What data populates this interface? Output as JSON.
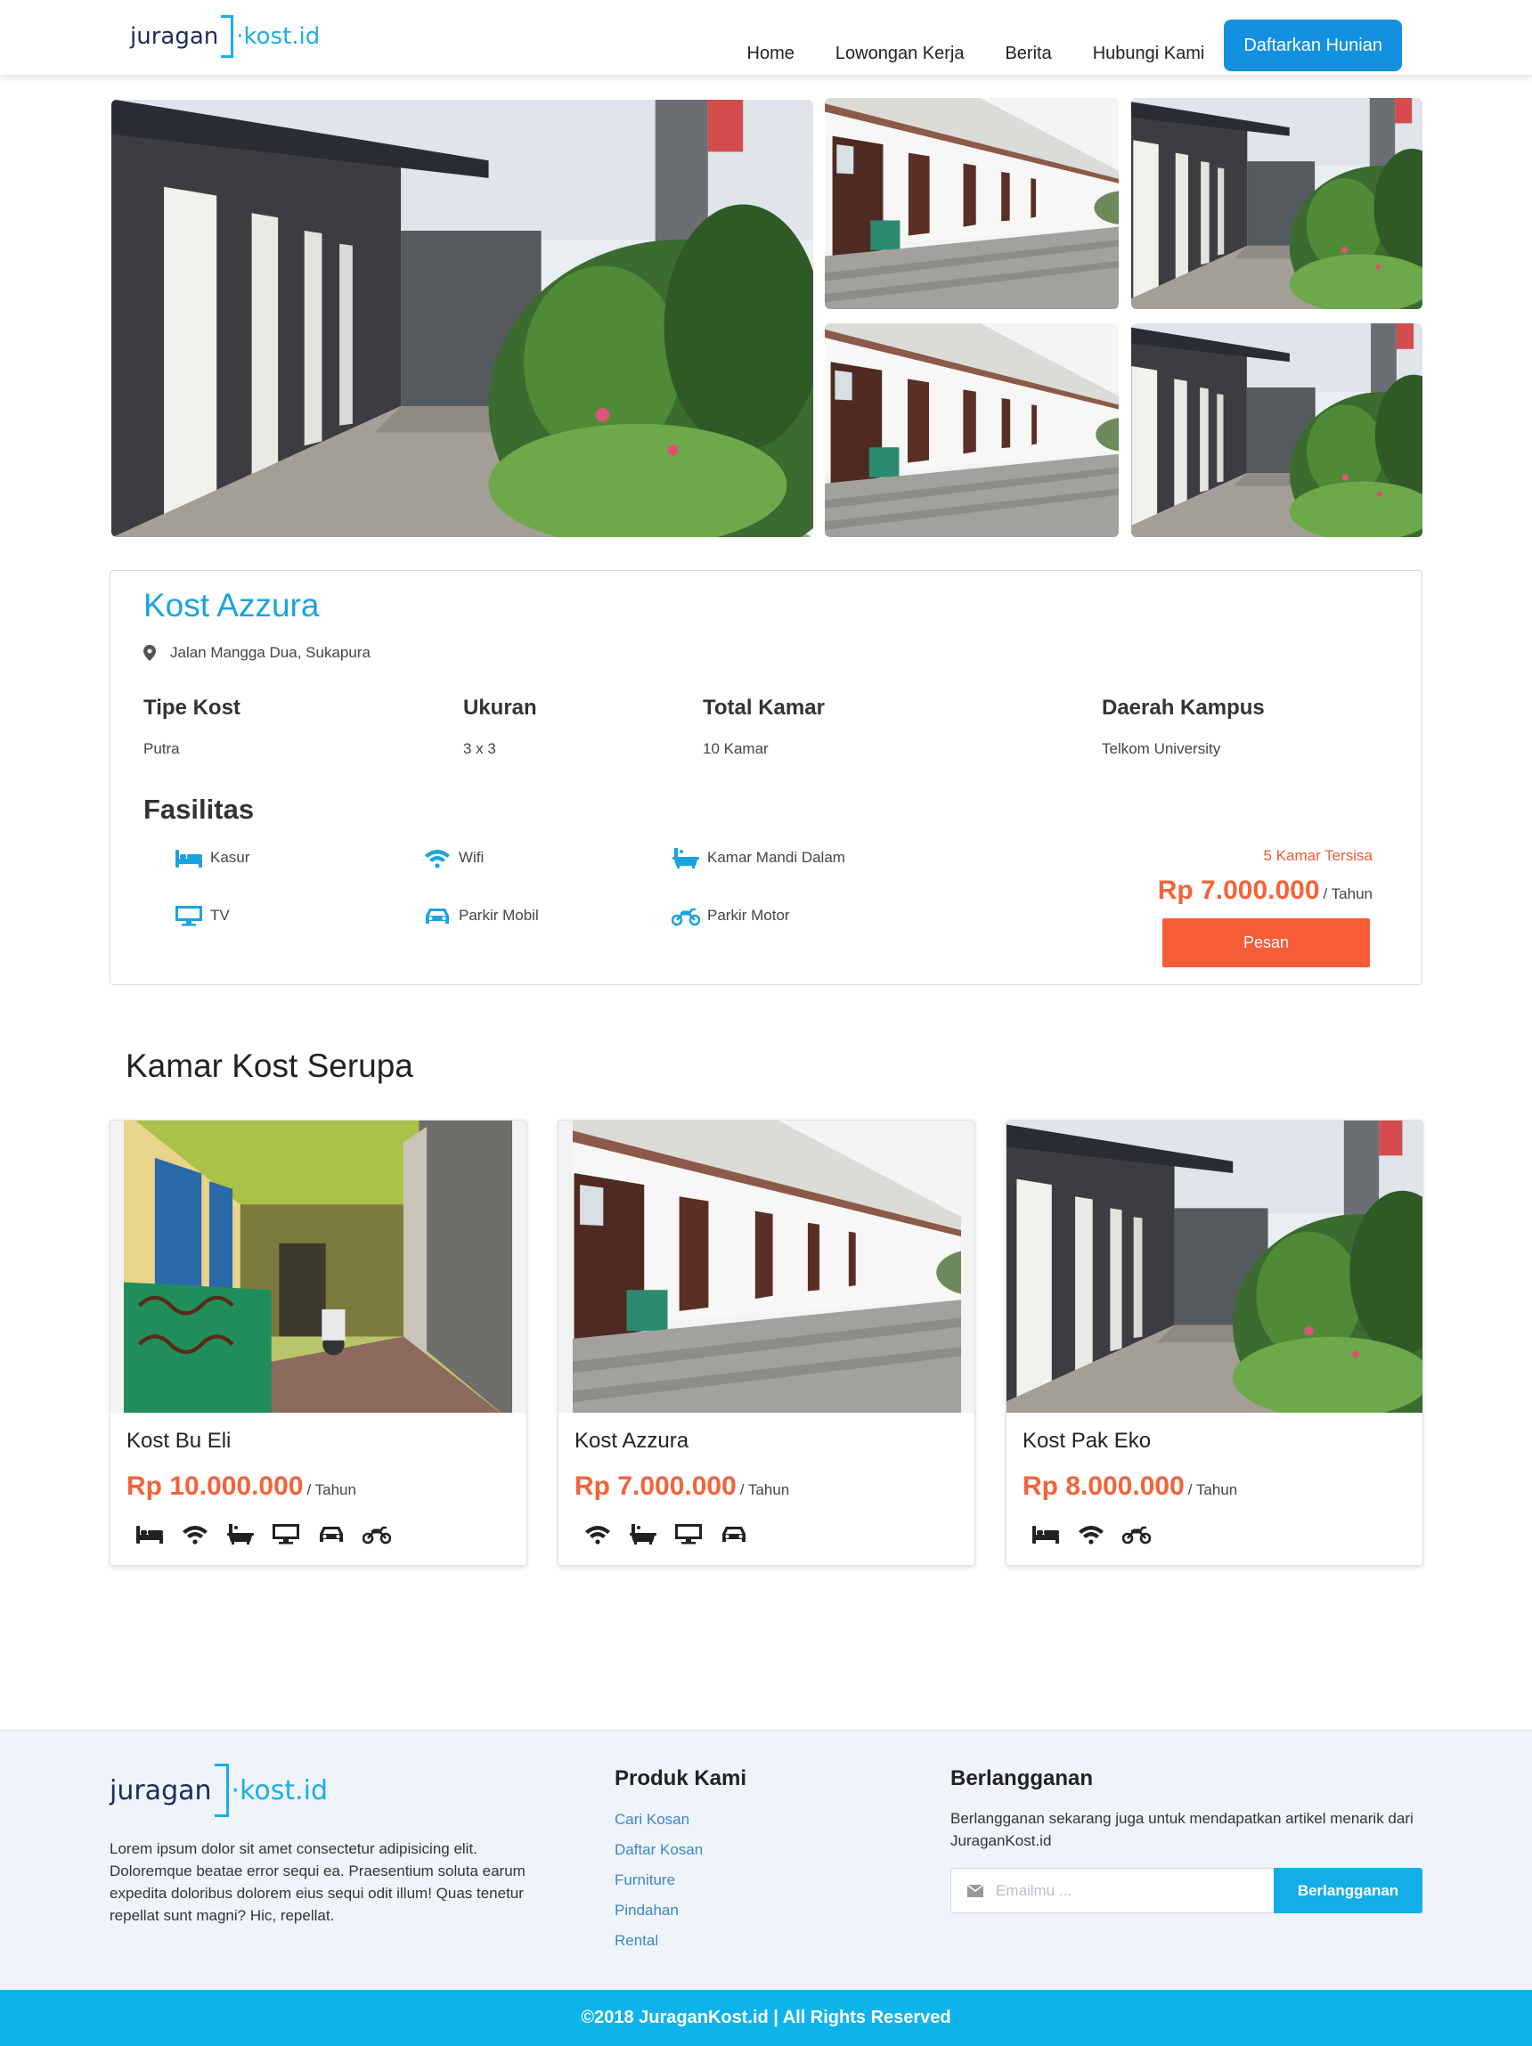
{
  "brand": {
    "name_left": "juragan",
    "name_dot": "·",
    "name_right": "kost.id"
  },
  "nav": {
    "links": [
      "Home",
      "Lowongan Kerja",
      "Berita",
      "Hubungi Kami"
    ],
    "cta": "Daftarkan Hunian"
  },
  "listing": {
    "name": "Kost Azzura",
    "address": "Jalan Mangga Dua, Sukapura",
    "specs": [
      {
        "label": "Tipe Kost",
        "value": "Putra"
      },
      {
        "label": "Ukuran",
        "value": "3 x 3"
      },
      {
        "label": "Total Kamar",
        "value": "10 Kamar"
      },
      {
        "label": "Daerah Kampus",
        "value": "Telkom University"
      }
    ],
    "facilities_title": "Fasilitas",
    "facilities": [
      {
        "label": "Kasur",
        "icon": "bed-icon"
      },
      {
        "label": "Wifi",
        "icon": "wifi-icon"
      },
      {
        "label": "Kamar Mandi Dalam",
        "icon": "bathtub-icon"
      },
      {
        "label": "TV",
        "icon": "tv-icon"
      },
      {
        "label": "Parkir Mobil",
        "icon": "car-icon"
      },
      {
        "label": "Parkir Motor",
        "icon": "motorcycle-icon"
      }
    ],
    "rooms_left": "5 Kamar Tersisa",
    "price": "Rp 7.000.000",
    "price_period": "/ Tahun",
    "book_label": "Pesan"
  },
  "similar": {
    "title": "Kamar Kost Serupa",
    "cards": [
      {
        "name": "Kost Bu Eli",
        "price": "Rp 10.000.000",
        "period": "/ Tahun",
        "icons": [
          "bed-icon",
          "wifi-icon",
          "bathtub-icon",
          "tv-icon",
          "car-icon",
          "motorcycle-icon"
        ]
      },
      {
        "name": "Kost Azzura",
        "price": "Rp 7.000.000",
        "period": "/ Tahun",
        "icons": [
          "wifi-icon",
          "bathtub-icon",
          "tv-icon",
          "car-icon"
        ]
      },
      {
        "name": "Kost Pak Eko",
        "price": "Rp 8.000.000",
        "period": "/ Tahun",
        "icons": [
          "bed-icon",
          "wifi-icon",
          "motorcycle-icon"
        ]
      }
    ]
  },
  "footer": {
    "about": "Lorem ipsum dolor sit amet consectetur adipisicing elit. Doloremque beatae error sequi ea. Praesentium soluta earum expedita doloribus dolorem eius sequi odit illum! Quas tenetur repellat sunt magni? Hic, repellat.",
    "products_title": "Produk Kami",
    "products": [
      "Cari Kosan",
      "Daftar Kosan",
      "Furniture",
      "Pindahan",
      "Rental"
    ],
    "subscribe_title": "Berlangganan",
    "subscribe_text": "Berlangganan sekarang juga untuk mendapatkan artikel menarik dari JuraganKost.id",
    "email_placeholder": "Emailmu ...",
    "subscribe_button": "Berlangganan",
    "copyright": "©2018 JuraganKost.id | All Rights Reserved"
  },
  "colors": {
    "accent": "#1aa3e0",
    "price": "#f2643a",
    "button_orange": "#f55d36",
    "footer_bar": "#0fb3ec"
  }
}
